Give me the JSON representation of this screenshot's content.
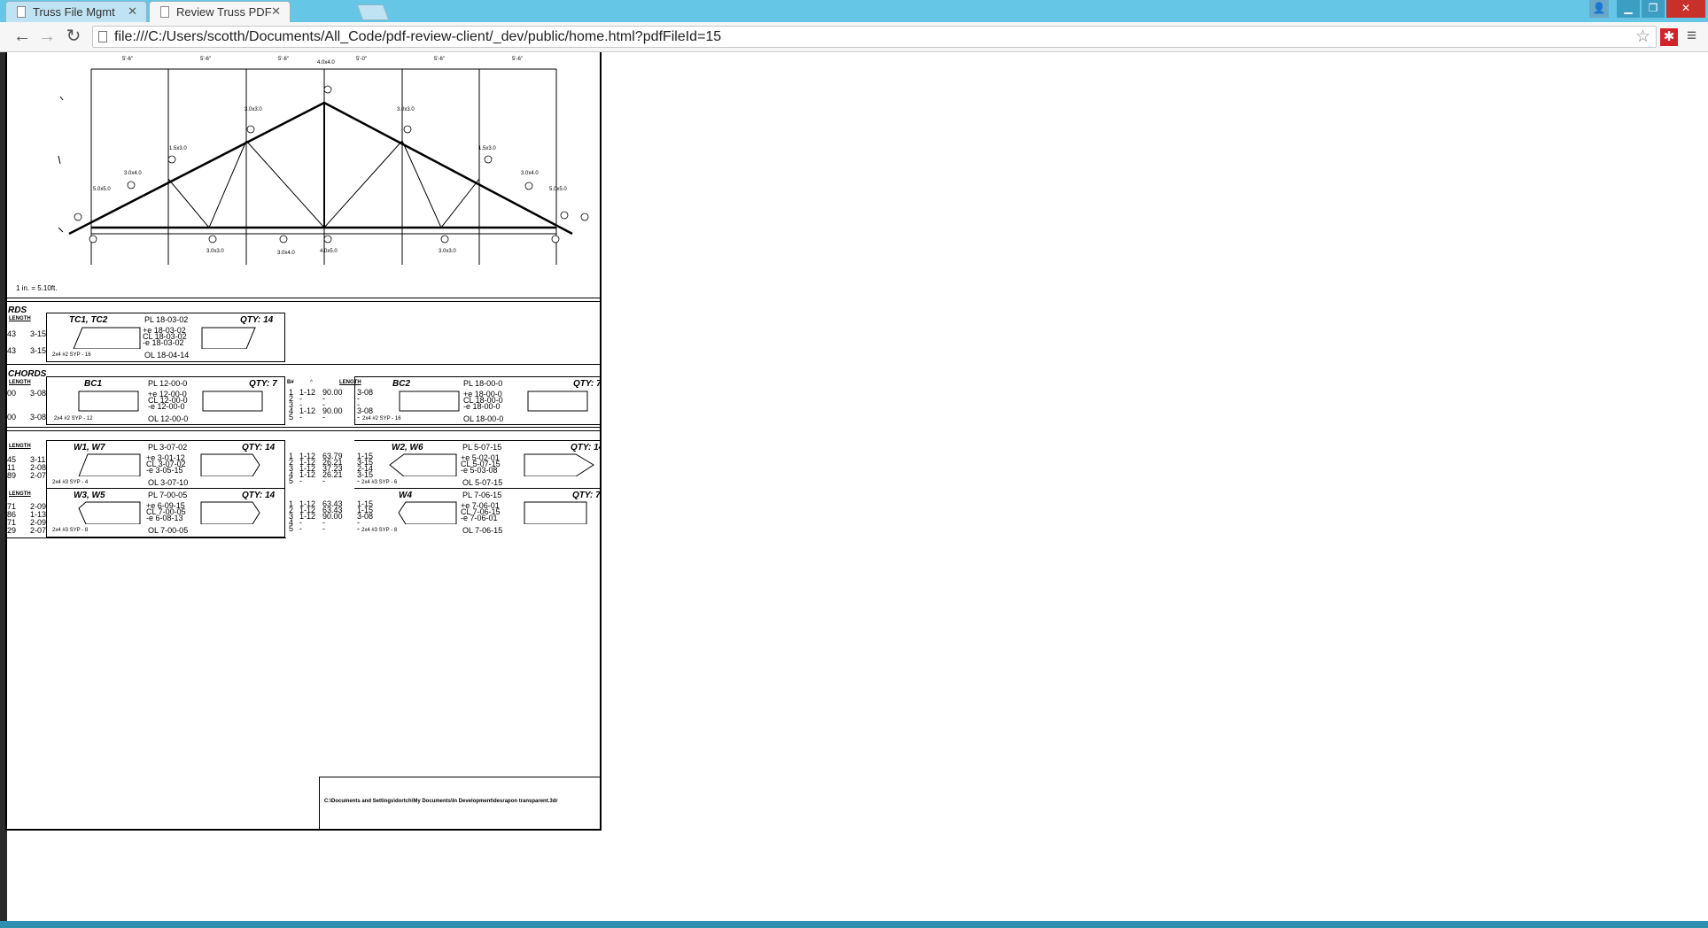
{
  "browser": {
    "tabs": [
      {
        "label": "Truss File Mgmt",
        "active": false
      },
      {
        "label": "Review Truss PDF",
        "active": true
      }
    ],
    "url": "file:///C:/Users/scotth/Documents/All_Code/pdf-review-client/_dev/public/home.html?pdfFileId=15",
    "colors": {
      "titlebar": "#65c6e6",
      "extension": "#d2232a"
    }
  },
  "pdf": {
    "scale_note": "1 in. = 5.10ft.",
    "dimensions_top": [
      "5'-6\"",
      "5'-6\"",
      "5'-6\"",
      "4.0x4.0",
      "5'-0\"",
      "5'-6\"",
      "5'-6\""
    ],
    "plate_labels": [
      "3.0x3.0",
      "3.0x3.0",
      "1.5x3.0",
      "1.5x3.0",
      "3.0x4.0",
      "3.0x4.0",
      "5.0x5.0",
      "5.0x5.0",
      "3.0x3.0",
      "3.0x4.0",
      "4.0x5.0",
      "3.0x3.0"
    ],
    "sections": {
      "top_chords": {
        "heading": "RDS",
        "col_header": "LENGTH",
        "rows": [
          [
            "43",
            "3-15"
          ],
          [
            "43",
            "3-15"
          ]
        ],
        "member": {
          "name": "TC1, TC2",
          "pl": "PL 18-03-02",
          "lines": [
            "+e 18-03-02",
            "CL 18-03-02",
            "-e 18-03-02"
          ],
          "ol": "OL 18-04-14",
          "qty": "QTY: 14",
          "lumber": "2x4 #2 SYP - 16"
        }
      },
      "bottom_chords": {
        "heading": "CHORDS",
        "col_header": "LENGTH",
        "left_rows": [
          [
            "00",
            "3-08"
          ],
          [
            "00",
            "3-08"
          ]
        ],
        "members": [
          {
            "name": "BC1",
            "pl": "PL 12-00-0",
            "lines": [
              "+e 12-00-0",
              "CL 12-00-0",
              "-e 12-00-0"
            ],
            "ol": "OL 12-00-0",
            "qty": "QTY: 7",
            "lumber": "2x4 #2 SYP - 12"
          },
          {
            "name": "BC2",
            "pl": "PL 18-00-0",
            "lines": [
              "+e 18-00-0",
              "CL 18-00-0",
              "-e 18-00-0"
            ],
            "ol": "OL 18-00-0",
            "qty": "QTY: 7",
            "lumber": "2x4 #2 SYP - 16"
          }
        ],
        "mid_header": [
          "B#",
          "^",
          "LENGTH"
        ],
        "mid_rows": [
          [
            "1",
            "1-12",
            "90.00",
            "3-08"
          ],
          [
            "2",
            "-",
            "-",
            "-"
          ],
          [
            "3",
            "-",
            "-",
            "-"
          ],
          [
            "4",
            "1-12",
            "90.00",
            "3-08"
          ],
          [
            "5",
            "-",
            "-",
            "-"
          ]
        ]
      },
      "webs": {
        "members": [
          {
            "name": "W1, W7",
            "pl": "PL 3-07-02",
            "lines": [
              "+e 3-01-12",
              "CL 3-07-02",
              "-e 3-05-15"
            ],
            "ol": "OL 3-07-10",
            "qty": "QTY: 14",
            "lumber": "2x4 #3 SYP - 4"
          },
          {
            "name": "W2, W6",
            "pl": "PL 5-07-15",
            "lines": [
              "+e 5-02-01",
              "CL 5-07-15",
              "-e 5-03-08"
            ],
            "ol": "OL 5-07-15",
            "qty": "QTY: 14",
            "lumber": "2x4 #3 SYP - 6"
          },
          {
            "name": "W3, W5",
            "pl": "PL 7-00-05",
            "lines": [
              "+e 6-09-15",
              "CL 7-00-05",
              "-e 6-08-13"
            ],
            "ol": "OL 7-00-05",
            "qty": "QTY: 14",
            "lumber": "2x4 #3 SYP - 8"
          },
          {
            "name": "W4",
            "pl": "PL 7-06-15",
            "lines": [
              "+e 7-06-01",
              "CL 7-06-15",
              "-e 7-06-01"
            ],
            "ol": "OL 7-06-15",
            "qty": "QTY: 7",
            "lumber": "2x4 #3 SYP - 8"
          }
        ],
        "left_rows_a": [
          [
            "45",
            "3-11"
          ],
          [
            "11",
            "2-08"
          ],
          [
            "89",
            "2-07"
          ]
        ],
        "left_rows_b": [
          [
            "71",
            "2-09"
          ],
          [
            "86",
            "1-13"
          ],
          [
            "71",
            "2-09"
          ],
          [
            "29",
            "2-07"
          ]
        ],
        "mid_rows_a": [
          [
            "1",
            "1-12",
            "63.79",
            "1-15"
          ],
          [
            "2",
            "1-12",
            "26.21",
            "3-15"
          ],
          [
            "3",
            "1-12",
            "37.23",
            "2-14"
          ],
          [
            "4",
            "1-12",
            "26.21",
            "3-15"
          ],
          [
            "5",
            "-",
            "-",
            "-"
          ]
        ],
        "mid_rows_b": [
          [
            "1",
            "1-12",
            "63.43",
            "1-15"
          ],
          [
            "2",
            "1-12",
            "63.43",
            "1-15"
          ],
          [
            "3",
            "1-12",
            "90.00",
            "3-08"
          ],
          [
            "4",
            "-",
            "-",
            "-"
          ],
          [
            "5",
            "-",
            "-",
            "-"
          ]
        ]
      }
    },
    "footer_path": "C:\\Documents and Settings\\dortch\\My Documents\\In Development\\desrapon transparent.3dr"
  }
}
